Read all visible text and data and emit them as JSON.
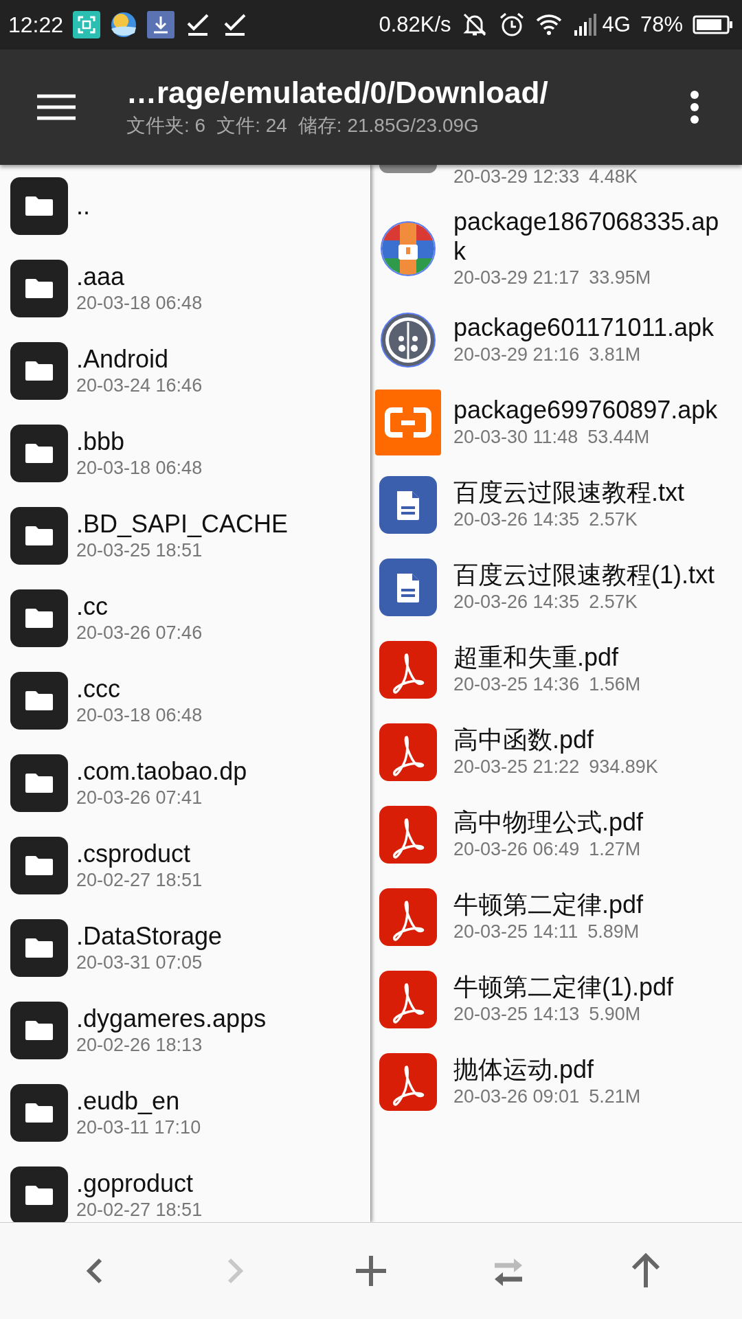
{
  "status_bar": {
    "time": "12:22",
    "net_speed": "0.82K/s",
    "network": "4G",
    "battery": "78%"
  },
  "toolbar": {
    "path": "…rage/emulated/0/Download/",
    "stats": [
      "文件夹: 6",
      "文件: 24",
      "储存: 21.85G/23.09G"
    ]
  },
  "left_pane": {
    "items": [
      {
        "kind": "folder",
        "name": ".."
      },
      {
        "kind": "folder",
        "name": ".aaa",
        "date": "20-03-18 06:48"
      },
      {
        "kind": "folder",
        "name": ".Android",
        "date": "20-03-24 16:46"
      },
      {
        "kind": "folder",
        "name": ".bbb",
        "date": "20-03-18 06:48"
      },
      {
        "kind": "folder",
        "name": ".BD_SAPI_CACHE",
        "date": "20-03-25 18:51"
      },
      {
        "kind": "folder",
        "name": ".cc",
        "date": "20-03-26 07:46"
      },
      {
        "kind": "folder",
        "name": ".ccc",
        "date": "20-03-18 06:48"
      },
      {
        "kind": "folder",
        "name": ".com.taobao.dp",
        "date": "20-03-26 07:41"
      },
      {
        "kind": "folder",
        "name": ".csproduct",
        "date": "20-02-27 18:51"
      },
      {
        "kind": "folder",
        "name": ".DataStorage",
        "date": "20-03-31 07:05"
      },
      {
        "kind": "folder",
        "name": ".dygameres.apps",
        "date": "20-02-26 18:13"
      },
      {
        "kind": "folder",
        "name": ".eudb_en",
        "date": "20-03-11 17:10"
      },
      {
        "kind": "folder",
        "name": ".goproduct",
        "date": "20-02-27 18:51"
      }
    ]
  },
  "right_pane": {
    "items": [
      {
        "kind": "generic",
        "date": "20-03-29 12:33",
        "size": "4.48K"
      },
      {
        "kind": "badge",
        "name": "package1867068335.apk",
        "date": "20-03-29 21:17",
        "size": "33.95M"
      },
      {
        "kind": "bug",
        "name": "package601171011.apk",
        "date": "20-03-29 21:16",
        "size": "3.81M"
      },
      {
        "kind": "brackets",
        "name": "package699760897.apk",
        "date": "20-03-30 11:48",
        "size": "53.44M"
      },
      {
        "kind": "document",
        "name": "百度云过限速教程.txt",
        "date": "20-03-26 14:35",
        "size": "2.57K"
      },
      {
        "kind": "document",
        "name": "百度云过限速教程(1).txt",
        "date": "20-03-26 14:35",
        "size": "2.57K"
      },
      {
        "kind": "pdf",
        "name": "超重和失重.pdf",
        "date": "20-03-25 14:36",
        "size": "1.56M"
      },
      {
        "kind": "pdf",
        "name": "高中函数.pdf",
        "date": "20-03-25 21:22",
        "size": "934.89K"
      },
      {
        "kind": "pdf",
        "name": "高中物理公式.pdf",
        "date": "20-03-26 06:49",
        "size": "1.27M"
      },
      {
        "kind": "pdf",
        "name": "牛顿第二定律.pdf",
        "date": "20-03-25 14:11",
        "size": "5.89M"
      },
      {
        "kind": "pdf",
        "name": "牛顿第二定律(1).pdf",
        "date": "20-03-25 14:13",
        "size": "5.90M"
      },
      {
        "kind": "pdf",
        "name": "抛体运动.pdf",
        "date": "20-03-26 09:01",
        "size": "5.21M"
      }
    ]
  },
  "bottom_bar": [
    {
      "kind": "back",
      "disabled": false
    },
    {
      "kind": "forward",
      "disabled": true
    },
    {
      "kind": "add",
      "disabled": false
    },
    {
      "kind": "swap",
      "disabled": false
    },
    {
      "kind": "up",
      "disabled": false
    }
  ]
}
